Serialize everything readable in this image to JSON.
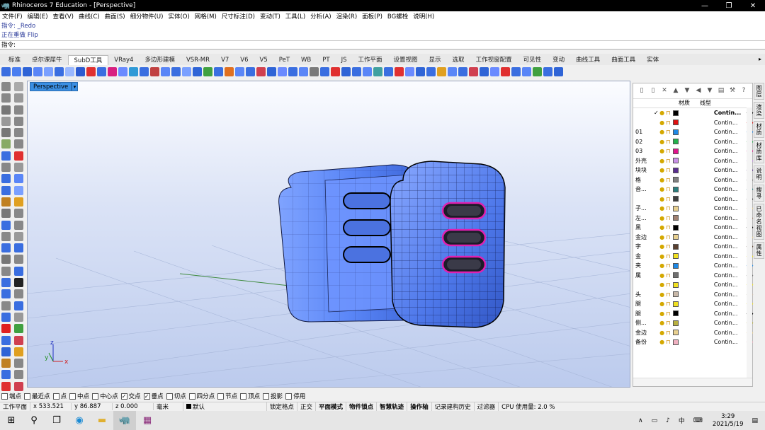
{
  "window": {
    "title": "Rhinoceros 7 Education - [Perspective]",
    "minimize": "—",
    "maximize": "❐",
    "close": "✕"
  },
  "menu": [
    "文件(F)",
    "编辑(E)",
    "查看(V)",
    "曲线(C)",
    "曲面(S)",
    "细分物件(U)",
    "实体(O)",
    "网格(M)",
    "尺寸标注(D)",
    "变动(T)",
    "工具(L)",
    "分析(A)",
    "渲染(R)",
    "面板(P)",
    "BG螺栓",
    "说明(H)"
  ],
  "command_history": [
    "指令: _Redo",
    "正在重做 Flip"
  ],
  "command_prompt": "指令:",
  "tabs": [
    "标准",
    "卓尔课犀牛",
    "SubD工具",
    "VRay4",
    "多边形建模",
    "VSR-MR",
    "V7",
    "V6",
    "V5",
    "PeT",
    "WB",
    "PT",
    "JS",
    "工作平面",
    "设置视图",
    "显示",
    "选取",
    "工作视窗配置",
    "可见性",
    "变动",
    "曲线工具",
    "曲面工具",
    "实体"
  ],
  "active_tab": "SubD工具",
  "viewport": {
    "name": "Perspective",
    "dropdown": "▾",
    "axes": {
      "x": "x",
      "y": "y",
      "z": "z"
    }
  },
  "layers_panel": {
    "header": {
      "material": "材质",
      "linetype": "线型"
    },
    "rows": [
      {
        "name": "",
        "check": "✓",
        "color": "#000000",
        "linetype": "Contin...",
        "bold": true
      },
      {
        "name": "",
        "check": "",
        "color": "#e01010",
        "linetype": "Contin..."
      },
      {
        "name": "01",
        "check": "",
        "color": "#1e88e5",
        "linetype": "Contin..."
      },
      {
        "name": "02",
        "check": "",
        "color": "#22b14c",
        "linetype": "Contin..."
      },
      {
        "name": "03",
        "check": "",
        "color": "#e0138c",
        "linetype": "Contin..."
      },
      {
        "name": "外壳",
        "check": "",
        "color": "#c990e8",
        "linetype": "Contin..."
      },
      {
        "name": "块块",
        "check": "",
        "color": "#5a2d91",
        "linetype": "Contin..."
      },
      {
        "name": "格",
        "check": "",
        "color": "#808080",
        "linetype": "Contin..."
      },
      {
        "name": "音...",
        "check": "",
        "color": "#2a7f7f",
        "linetype": "Contin..."
      },
      {
        "name": "",
        "check": "",
        "color": "#404040",
        "linetype": "Contin..."
      },
      {
        "name": "子...",
        "check": "",
        "color": "#e8d090",
        "linetype": "Contin..."
      },
      {
        "name": "左...",
        "check": "",
        "color": "#a08070",
        "linetype": "Contin..."
      },
      {
        "name": "黑",
        "check": "",
        "color": "#000000",
        "linetype": "Contin..."
      },
      {
        "name": "金边",
        "check": "",
        "color": "#e8d090",
        "linetype": "Contin..."
      },
      {
        "name": "字",
        "check": "",
        "color": "#5a4030",
        "linetype": "Contin..."
      },
      {
        "name": "金",
        "check": "",
        "color": "#f0e020",
        "linetype": "Contin..."
      },
      {
        "name": "夹",
        "check": "",
        "color": "#1e88e5",
        "linetype": "Contin..."
      },
      {
        "name": "属",
        "check": "",
        "color": "#707070",
        "linetype": "Contin..."
      },
      {
        "name": "",
        "check": "",
        "color": "#f0e020",
        "linetype": "Contin..."
      },
      {
        "name": "头",
        "check": "",
        "color": "#c8b8a8",
        "linetype": "Contin..."
      },
      {
        "name": "腿",
        "check": "",
        "color": "#f0e020",
        "linetype": "Contin..."
      },
      {
        "name": "腿",
        "check": "",
        "color": "#000000",
        "linetype": "Contin..."
      },
      {
        "name": "侧...",
        "check": "",
        "color": "#b8b040",
        "linetype": "Contin..."
      },
      {
        "name": "金边",
        "check": "",
        "color": "#e8d090",
        "linetype": "Contin..."
      },
      {
        "name": "备份",
        "check": "",
        "color": "#f0b0c0",
        "linetype": "Contin..."
      }
    ]
  },
  "side_tabs": [
    "图层",
    "渲染",
    "材质",
    "材质库",
    "说明",
    "搜寻",
    "已命名视图",
    "属性"
  ],
  "osnaps": [
    {
      "label": "端点",
      "on": false
    },
    {
      "label": "最近点",
      "on": false
    },
    {
      "label": "点",
      "on": false
    },
    {
      "label": "中点",
      "on": false
    },
    {
      "label": "中心点",
      "on": false
    },
    {
      "label": "交点",
      "on": true
    },
    {
      "label": "垂点",
      "on": true
    },
    {
      "label": "切点",
      "on": false
    },
    {
      "label": "四分点",
      "on": false
    },
    {
      "label": "节点",
      "on": false
    },
    {
      "label": "顶点",
      "on": false
    },
    {
      "label": "投影",
      "on": false
    },
    {
      "label": "停用",
      "on": false
    }
  ],
  "status": {
    "cplane": "工作平面",
    "x": "x 533.521",
    "y": "y 86.887",
    "z": "z 0.000",
    "units": "毫米",
    "layer": "默认",
    "toggles": [
      "锁定格点",
      "正交",
      "平面模式",
      "物件锁点",
      "智慧轨迹",
      "操作轴",
      "记录建构历史",
      "过滤器"
    ],
    "cpu": "CPU 使用量: 2.0 %"
  },
  "taskbar": {
    "time": "3:29",
    "date": "2021/5/19",
    "ime": "中"
  }
}
